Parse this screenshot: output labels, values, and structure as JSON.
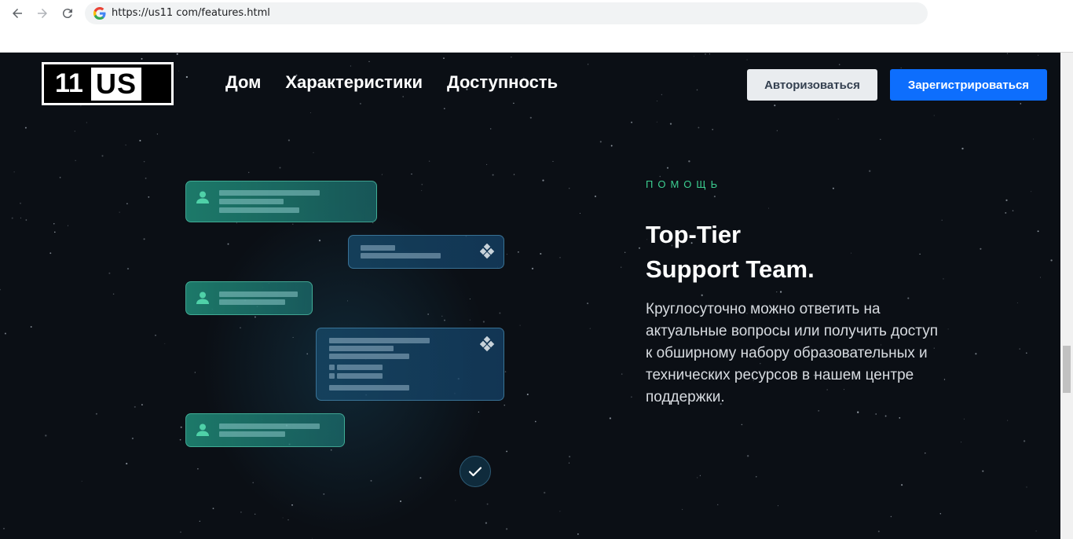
{
  "browser": {
    "url": "https://us11 com/features.html",
    "back_icon": "arrow-left-icon",
    "forward_icon": "arrow-right-icon",
    "reload_icon": "reload-icon"
  },
  "header": {
    "logo": {
      "number": "11",
      "letters": "US"
    },
    "menu": [
      {
        "label": "Дом"
      },
      {
        "label": "Характеристики"
      },
      {
        "label": "Доступность"
      }
    ],
    "login_label": "Авторизоваться",
    "signup_label": "Зарегистрироваться"
  },
  "section": {
    "eyebrow": "ПОМОЩЬ",
    "title_line1": "Top-Tier",
    "title_line2": "Support Team.",
    "description": "Круглосуточно можно ответить на актуальные вопросы или получить доступ к обширному набору образовательных и технических ресурсов в нашем центре поддержки."
  },
  "colors": {
    "background": "#0b0f15",
    "accent_green": "#3ccf91",
    "signup_blue": "#0d6efd",
    "login_gray": "#e9ecef"
  }
}
